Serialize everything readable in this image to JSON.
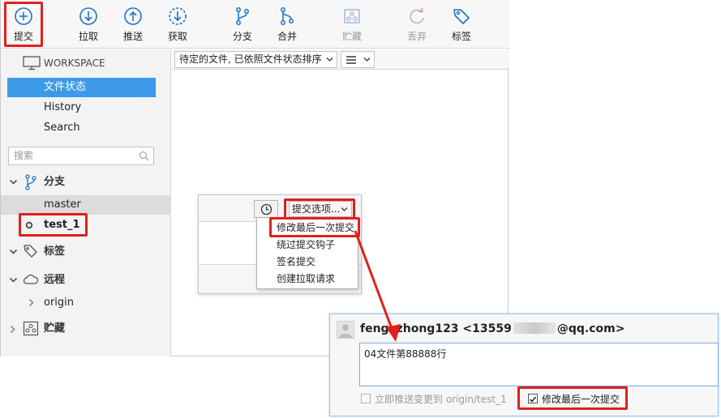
{
  "toolbar": {
    "commit": "提交",
    "pull": "拉取",
    "push": "推送",
    "fetch": "获取",
    "branch": "分支",
    "merge": "合并",
    "stash": "贮藏",
    "discard": "丢弃",
    "tag": "标签"
  },
  "sidebar": {
    "workspace_title": "WORKSPACE",
    "items": [
      "文件状态",
      "History",
      "Search"
    ],
    "search_placeholder": "搜索",
    "branches_title": "分支",
    "branches": [
      "master",
      "test_1"
    ],
    "tags_title": "标签",
    "remotes_title": "远程",
    "remotes": [
      "origin"
    ],
    "stashes_title": "贮藏"
  },
  "filterbar": {
    "sort_label": "待定的文件, 已依照文件状态排序",
    "view_icon": "list-icon"
  },
  "commit_options": {
    "button_label": "提交选项...",
    "menu": [
      "修改最后一次提交",
      "绕过提交钩子",
      "签名提交",
      "创建拉取请求"
    ]
  },
  "dialog": {
    "author": "fengxzhong123 <13559",
    "author_email_tail": "@qq.com>",
    "message": "04文件第88888行",
    "push_label": "立即推送变更到 origin/test_1",
    "push_checked": false,
    "amend_label": "修改最后一次提交",
    "amend_checked": true
  },
  "colors": {
    "selection": "#3d9ae8",
    "accent": "#1e73c8",
    "highlight_red": "#e02020"
  }
}
